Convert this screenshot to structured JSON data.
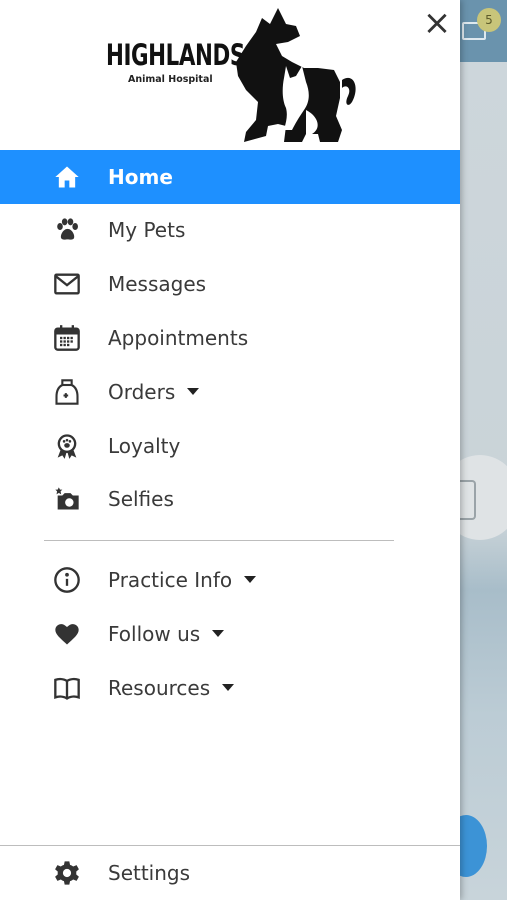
{
  "background_app": {
    "badge_count": "5",
    "mail_icon": "mail-icon"
  },
  "drawer": {
    "close_icon": "close-icon",
    "logo": {
      "title": "HIGHLANDS",
      "subtitle": "Animal Hospital"
    },
    "menu": [
      {
        "label": "Home",
        "icon": "home-icon",
        "active": true
      },
      {
        "label": "My Pets",
        "icon": "paw-icon"
      },
      {
        "label": "Messages",
        "icon": "envelope-icon"
      },
      {
        "label": "Appointments",
        "icon": "calendar-icon"
      },
      {
        "label": "Orders",
        "icon": "food-bag-icon",
        "expandable": true
      },
      {
        "label": "Loyalty",
        "icon": "award-icon"
      },
      {
        "label": "Selfies",
        "icon": "camera-icon"
      }
    ],
    "secondary_menu": [
      {
        "label": "Practice Info",
        "icon": "info-icon",
        "expandable": true
      },
      {
        "label": "Follow us",
        "icon": "heart-icon",
        "expandable": true
      },
      {
        "label": "Resources",
        "icon": "book-icon",
        "expandable": true
      }
    ],
    "settings": {
      "label": "Settings",
      "icon": "gear-icon"
    }
  },
  "colors": {
    "active_item": "#1e90ff",
    "text": "#3a3a3a",
    "icon": "#333333"
  }
}
